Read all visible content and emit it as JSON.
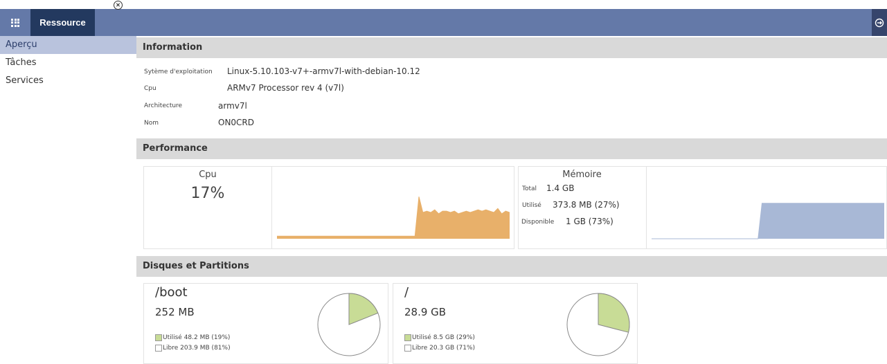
{
  "topbar": {
    "apps_icon": "grid-icon",
    "tab_label": "Ressource",
    "tab_close_icon": "close-circle-icon",
    "logout_icon": "logout-icon",
    "color": "#6479a8",
    "tab_color": "#23395f"
  },
  "sidebar": {
    "items": [
      {
        "label": "Aperçu",
        "active": true
      },
      {
        "label": "Tâches",
        "active": false
      },
      {
        "label": "Services",
        "active": false
      }
    ]
  },
  "information": {
    "title": "Information",
    "rows": [
      {
        "label": "Sytème d'exploitation",
        "value": "Linux-5.10.103-v7+-armv7l-with-debian-10.12"
      },
      {
        "label": "Cpu",
        "value": "ARMv7 Processor rev 4 (v7l)"
      },
      {
        "label": "Architecture",
        "value": "armv7l"
      },
      {
        "label": "Nom",
        "value": "ON0CRD"
      }
    ]
  },
  "performance": {
    "title": "Performance",
    "cpu": {
      "title": "Cpu",
      "value": "17%",
      "color": "#e8b06a",
      "series": [
        2,
        2,
        2,
        2,
        2,
        2,
        2,
        2,
        2,
        2,
        2,
        2,
        2,
        2,
        2,
        2,
        2,
        2,
        2,
        2,
        2,
        2,
        2,
        2,
        2,
        2,
        2,
        2,
        2,
        2,
        2,
        2,
        2,
        2,
        2,
        2,
        32,
        20,
        21,
        20,
        22,
        19,
        21,
        21,
        20,
        21,
        19,
        20,
        21,
        20,
        21,
        22,
        21,
        22,
        21,
        20,
        23,
        19,
        21,
        20
      ]
    },
    "memory": {
      "title": "Mémoire",
      "total_label": "Total",
      "total_value": "1.4 GB",
      "used_label": "Utilisé",
      "used_value": "373.8 MB (27%)",
      "free_label": "Disponible",
      "free_value": "1 GB (73%)",
      "color": "#a8b8d6",
      "series": [
        0,
        0,
        0,
        0,
        0,
        0,
        0,
        0,
        0,
        0,
        0,
        0,
        0,
        0,
        0,
        0,
        0,
        0,
        0,
        0,
        0,
        0,
        0,
        0,
        0,
        0,
        0,
        0,
        27,
        27,
        27,
        27,
        27,
        27,
        27,
        27,
        27,
        27,
        27,
        27,
        27,
        27,
        27,
        27,
        27,
        27,
        27,
        27,
        27,
        27,
        27,
        27,
        27,
        27,
        27,
        27,
        27,
        27,
        27,
        27
      ]
    }
  },
  "disks": {
    "title": "Disques et Partitions",
    "used_color": "#c8dc96",
    "items": [
      {
        "name": "/boot",
        "size": "252 MB",
        "used_label": "Utilisé 48.2 MB (19%)",
        "free_label": "Libre 203.9 MB (81%)",
        "used_fraction": 0.19
      },
      {
        "name": "/",
        "size": "28.9 GB",
        "used_label": "Utilisé 8.5 GB (29%)",
        "free_label": "Libre 20.3 GB (71%)",
        "used_fraction": 0.29
      }
    ]
  }
}
